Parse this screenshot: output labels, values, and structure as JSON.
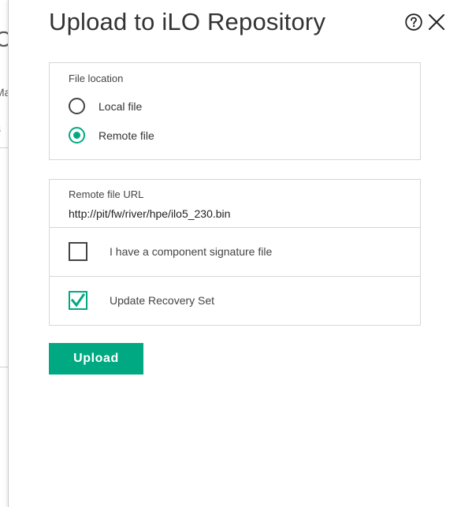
{
  "background": {
    "fragments": [
      "C",
      "Ma",
      "s"
    ]
  },
  "dialog": {
    "title": "Upload to iLO Repository",
    "help_icon": "help-circle-icon",
    "close_icon": "close-icon"
  },
  "file_location": {
    "label": "File location",
    "options": [
      {
        "label": "Local file",
        "selected": false
      },
      {
        "label": "Remote file",
        "selected": true
      }
    ]
  },
  "remote": {
    "url_label": "Remote file URL",
    "url_value": "http://pit/fw/river/hpe/ilo5_230.bin",
    "signature_label": "I have a component signature file",
    "signature_checked": false,
    "recovery_label": "Update Recovery Set",
    "recovery_checked": true
  },
  "actions": {
    "upload_label": "Upload"
  },
  "colors": {
    "accent": "#01a982"
  }
}
